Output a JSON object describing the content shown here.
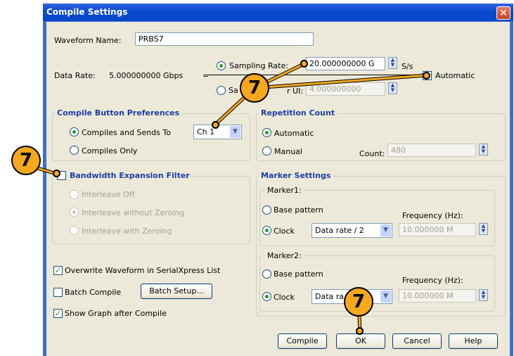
{
  "dialog": {
    "title": "Compile Settings",
    "close": "✕"
  },
  "waveform": {
    "label": "Waveform Name:",
    "value": "PRBS7"
  },
  "data_rate": {
    "label": "Data Rate:",
    "value": "5.000000000 Gbps",
    "equals": "=",
    "sampling_rate_label": "Sampling Rate:",
    "sampling_rate_value": "20.000000000 G",
    "sampling_unit": "S/s",
    "samples_label_left": "Sa",
    "samples_label_right": "r UI:",
    "samples_value": "4.000000000",
    "automatic_label": "Automatic"
  },
  "compile_prefs": {
    "title": "Compile Button Preferences",
    "option1": "Compiles and Sends To",
    "option2": "Compiles Only",
    "channel": "Ch 1"
  },
  "repetition": {
    "title": "Repetition Count",
    "automatic": "Automatic",
    "manual": "Manual",
    "count_label": "Count:",
    "count_value": "480"
  },
  "bandwidth": {
    "title": "Bandwidth Expansion Filter",
    "opt1": "Interleave Off",
    "opt2": "Interleave without Zeroing",
    "opt3": "Interleave with Zeroing"
  },
  "markers": {
    "title": "Marker Settings",
    "marker1": {
      "label": "Marker1:",
      "base": "Base pattern",
      "freq_label": "Frequency (Hz):",
      "clock": "Clock",
      "clock_value": "Data rate / 2",
      "freq_value": "10.000000 M"
    },
    "marker2": {
      "label": "Marker2:",
      "base": "Base pattern",
      "freq_label": "Frequency (Hz):",
      "clock": "Clock",
      "clock_value": "Data ra",
      "freq_value": "10.000000 M"
    }
  },
  "options": {
    "overwrite": "Overwrite Waveform in SerialXpress List",
    "batch_compile": "Batch Compile",
    "batch_setup": "Batch Setup...",
    "show_graph": "Show Graph after Compile"
  },
  "buttons": {
    "compile": "Compile",
    "ok": "OK",
    "cancel": "Cancel",
    "help": "Help"
  },
  "callouts": {
    "number": "7"
  },
  "colors": {
    "title_bar": "#0a48d0",
    "callout": "#f6a81c",
    "group_title": "#1c3ea5",
    "face": "#ece9d8"
  }
}
